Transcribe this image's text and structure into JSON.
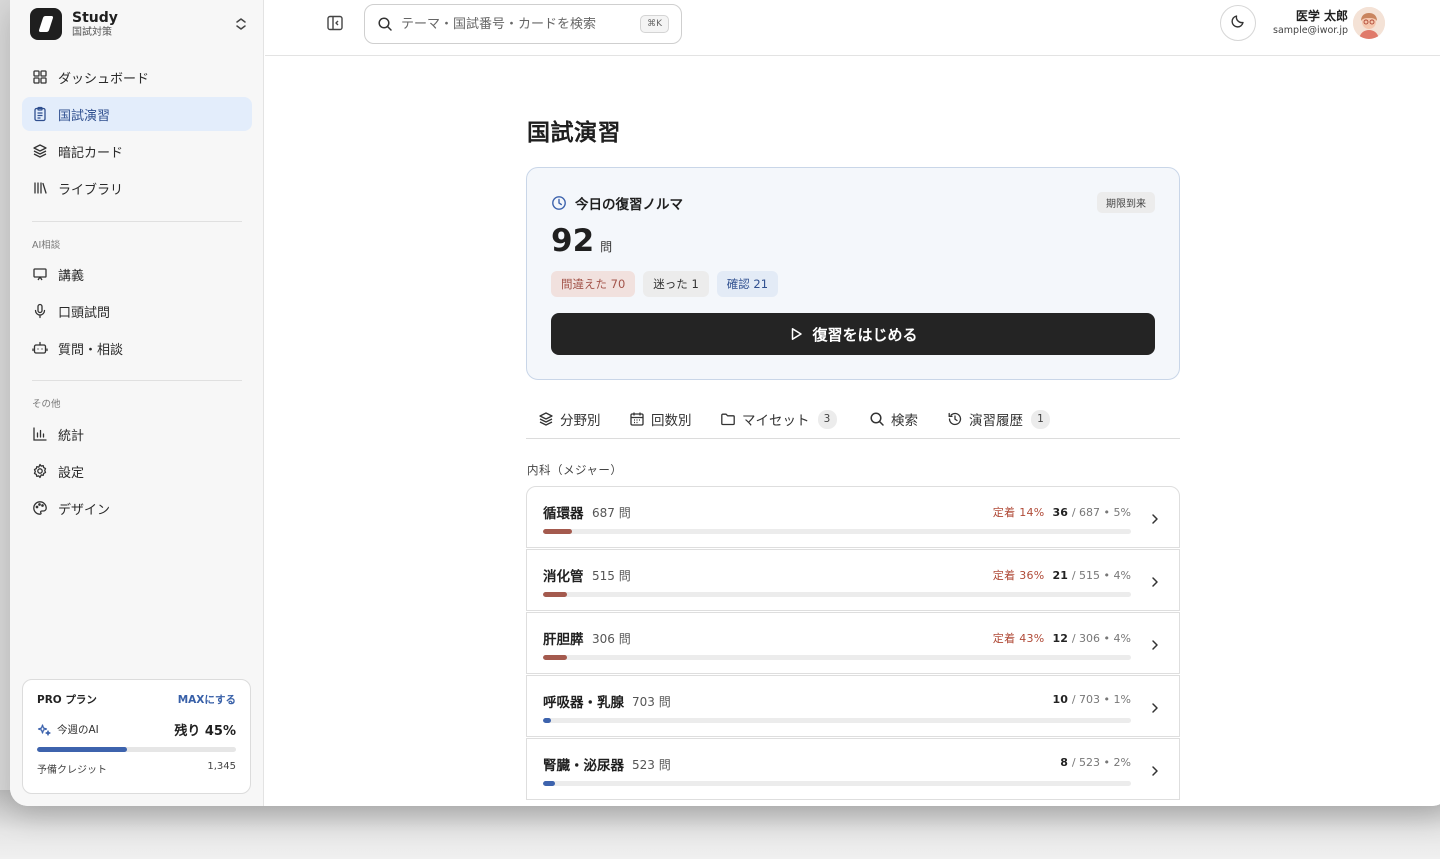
{
  "brand": {
    "name": "Study",
    "subtitle": "国試対策"
  },
  "nav": {
    "main": [
      {
        "label": "ダッシュボード",
        "icon": "grid-icon",
        "active": false
      },
      {
        "label": "国試演習",
        "icon": "clipboard-icon",
        "active": true
      },
      {
        "label": "暗記カード",
        "icon": "layers-icon",
        "active": false
      },
      {
        "label": "ライブラリ",
        "icon": "library-icon",
        "active": false
      }
    ],
    "ai_section": "AI相談",
    "ai": [
      {
        "label": "講義",
        "icon": "presentation-icon"
      },
      {
        "label": "口頭試問",
        "icon": "microphone-icon"
      },
      {
        "label": "質問・相談",
        "icon": "bot-icon"
      }
    ],
    "other_section": "その他",
    "other": [
      {
        "label": "統計",
        "icon": "bar-chart-icon"
      },
      {
        "label": "設定",
        "icon": "gear-icon"
      },
      {
        "label": "デザイン",
        "icon": "palette-icon"
      }
    ]
  },
  "plan": {
    "title": "PRO プラン",
    "upgrade": "MAXにする",
    "ai_label": "今週のAI",
    "ai_remaining": "残り 45%",
    "ai_fraction": 0.45,
    "credit_label": "予備クレジット",
    "credit_value": "1,345"
  },
  "header": {
    "search_placeholder": "テーマ・国試番号・カードを検索",
    "shortcut": "⌘K",
    "user_name": "医学 太郎",
    "user_email": "sample@iwor.jp"
  },
  "page": {
    "title": "国試演習",
    "review": {
      "title": "今日の復習ノルマ",
      "badge": "期限到来",
      "count": "92",
      "unit": "問",
      "chips": {
        "wrong": "間違えた 70",
        "unsure": "迷った 1",
        "confirm": "確認 21"
      },
      "start": "復習をはじめる"
    },
    "tabs": [
      {
        "label": "分野別",
        "icon": "layers-icon",
        "count": ""
      },
      {
        "label": "回数別",
        "icon": "calendar-icon",
        "count": ""
      },
      {
        "label": "マイセット",
        "icon": "folder-icon",
        "count": "3"
      },
      {
        "label": "検索",
        "icon": "search-icon",
        "count": ""
      },
      {
        "label": "演習履歴",
        "icon": "history-icon",
        "count": "1"
      }
    ],
    "section": "内科（メジャー）",
    "categories": [
      {
        "name": "循環器",
        "total": "687 問",
        "retention": "定着 14%",
        "done": "36",
        "rest": "/ 687 • 5%",
        "progress": 0.05,
        "color": "#a45a4e"
      },
      {
        "name": "消化管",
        "total": "515 問",
        "retention": "定着 36%",
        "done": "21",
        "rest": "/ 515 • 4%",
        "progress": 0.04,
        "color": "#a45a4e"
      },
      {
        "name": "肝胆膵",
        "total": "306 問",
        "retention": "定着 43%",
        "done": "12",
        "rest": "/ 306 • 4%",
        "progress": 0.04,
        "color": "#a45a4e"
      },
      {
        "name": "呼吸器・乳腺",
        "total": "703 問",
        "retention": "",
        "done": "10",
        "rest": "/ 703 • 1%",
        "progress": 0.01,
        "color": "#3d63ad"
      },
      {
        "name": "腎臓・泌尿器",
        "total": "523 問",
        "retention": "",
        "done": "8",
        "rest": "/ 523 • 2%",
        "progress": 0.02,
        "color": "#3d63ad"
      }
    ]
  }
}
